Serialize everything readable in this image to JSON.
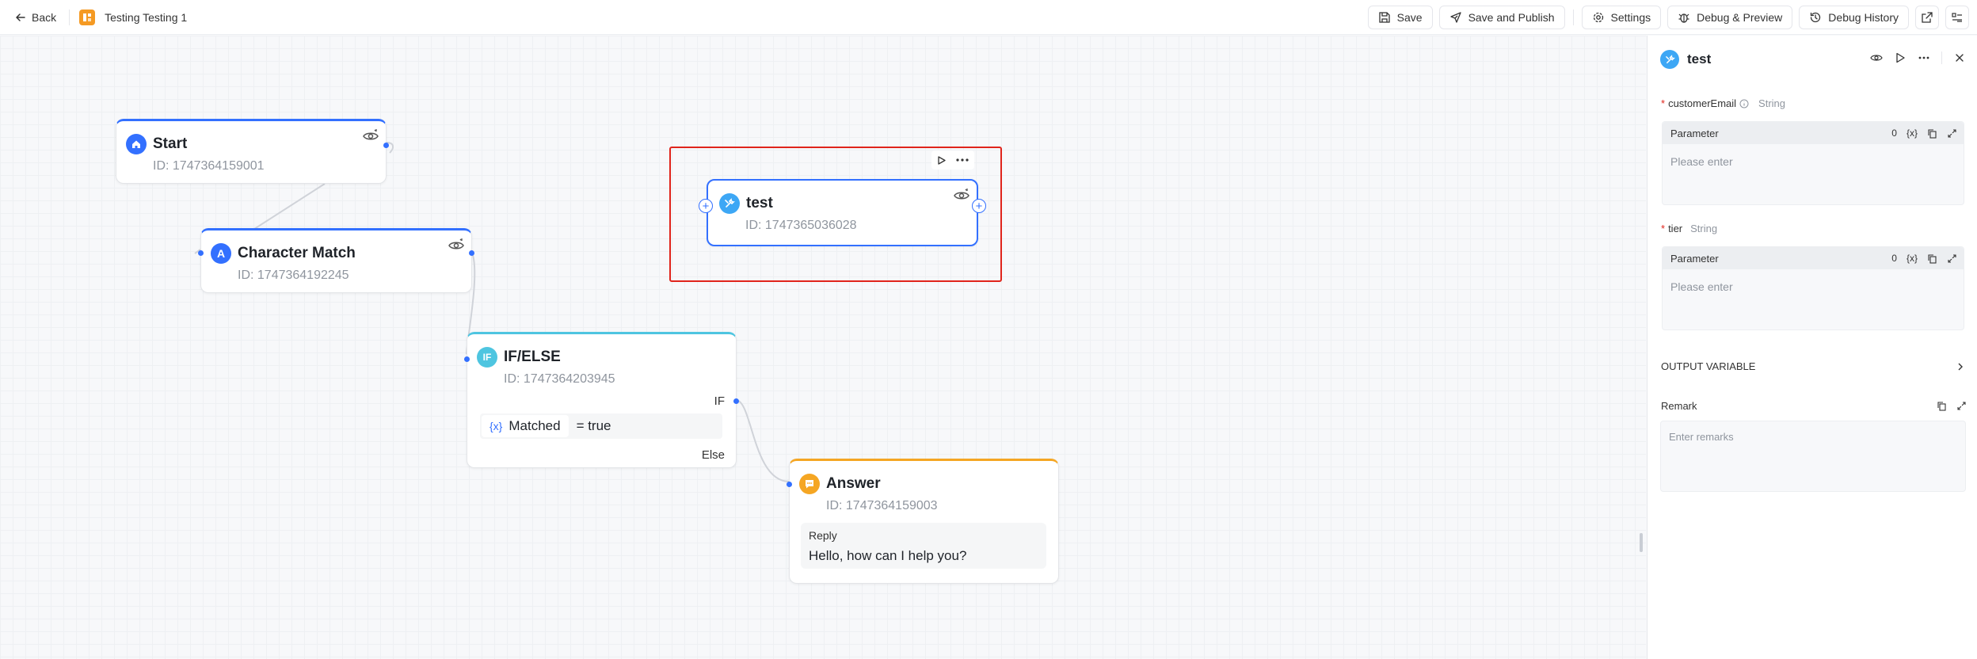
{
  "topbar": {
    "back_label": "Back",
    "app_title": "Testing Testing 1",
    "save_label": "Save",
    "save_publish_label": "Save and Publish",
    "settings_label": "Settings",
    "debug_preview_label": "Debug & Preview",
    "debug_history_label": "Debug History"
  },
  "nodes": {
    "start": {
      "title": "Start",
      "id_text": "ID: 1747364159001",
      "icon": "home-icon"
    },
    "char_match": {
      "title": "Character Match",
      "id_text": "ID: 1747364192245",
      "icon_letter": "A"
    },
    "test": {
      "title": "test",
      "id_text": "ID: 1747365036028",
      "icon": "tool-icon"
    },
    "ifelse": {
      "title": "IF/ELSE",
      "id_text": "ID: 1747364203945",
      "icon_letter": "IF",
      "if_label": "IF",
      "else_label": "Else",
      "condition": {
        "variable": "Matched",
        "operator": "= true"
      }
    },
    "answer": {
      "title": "Answer",
      "id_text": "ID: 1747364159003",
      "reply_label": "Reply",
      "reply_text": "Hello, how can I help you?"
    }
  },
  "panel": {
    "title": "test",
    "fields": [
      {
        "name": "customerEmail",
        "type": "String",
        "param_label": "Parameter",
        "count": "0",
        "placeholder": "Please enter"
      },
      {
        "name": "tier",
        "type": "String",
        "param_label": "Parameter",
        "count": "0",
        "placeholder": "Please enter"
      }
    ],
    "output_variable_label": "OUTPUT VARIABLE",
    "remark_label": "Remark",
    "remark_placeholder": "Enter remarks"
  },
  "colors": {
    "accent": "#3370ff",
    "selection": "#e0241b",
    "start": "#3370ff",
    "if_node": "#4ec5e0",
    "answer": "#f5a623",
    "tool": "#3da7f5"
  }
}
